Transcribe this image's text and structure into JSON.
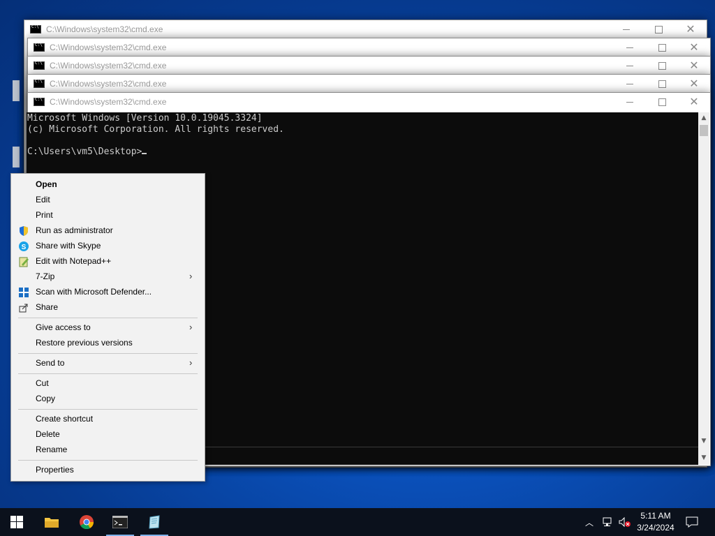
{
  "windows": {
    "title": "C:\\Windows\\system32\\cmd.exe",
    "count_stacked": 5
  },
  "console": {
    "lines": [
      "Microsoft Windows [Version 10.0.19045.3324]",
      "(c) Microsoft Corporation. All rights reserved.",
      "",
      "C:\\Users\\vm5\\Desktop>"
    ]
  },
  "context_menu": {
    "items": [
      {
        "label": "Open",
        "icon": "",
        "bold": true
      },
      {
        "label": "Edit",
        "icon": ""
      },
      {
        "label": "Print",
        "icon": ""
      },
      {
        "label": "Run as administrator",
        "icon": "uac-shield-icon"
      },
      {
        "label": "Share with Skype",
        "icon": "skype-icon"
      },
      {
        "label": "Edit with Notepad++",
        "icon": "notepadpp-icon"
      },
      {
        "label": "7-Zip",
        "icon": "",
        "submenu": true
      },
      {
        "label": "Scan with Microsoft Defender...",
        "icon": "defender-icon"
      },
      {
        "label": "Share",
        "icon": "share-icon"
      },
      {
        "label": "Give access to",
        "icon": "",
        "submenu": true
      },
      {
        "label": "Restore previous versions",
        "icon": ""
      },
      {
        "label": "Send to",
        "icon": "",
        "submenu": true
      },
      {
        "label": "Cut",
        "icon": ""
      },
      {
        "label": "Copy",
        "icon": ""
      },
      {
        "label": "Create shortcut",
        "icon": ""
      },
      {
        "label": "Delete",
        "icon": ""
      },
      {
        "label": "Rename",
        "icon": ""
      },
      {
        "label": "Properties",
        "icon": ""
      }
    ]
  },
  "taskbar": {
    "apps": [
      "windows-start-icon",
      "file-explorer-icon",
      "chrome-icon",
      "cmd-icon",
      "notepad-icon"
    ],
    "clock": {
      "time": "5:11 AM",
      "date": "3/24/2024"
    }
  },
  "colors": {
    "desktop": "#0a4fb8",
    "console_bg": "#0c0c0c",
    "console_fg": "#cccccc",
    "menu_bg": "#f2f2f2",
    "taskbar_bg": "#0b111c"
  }
}
